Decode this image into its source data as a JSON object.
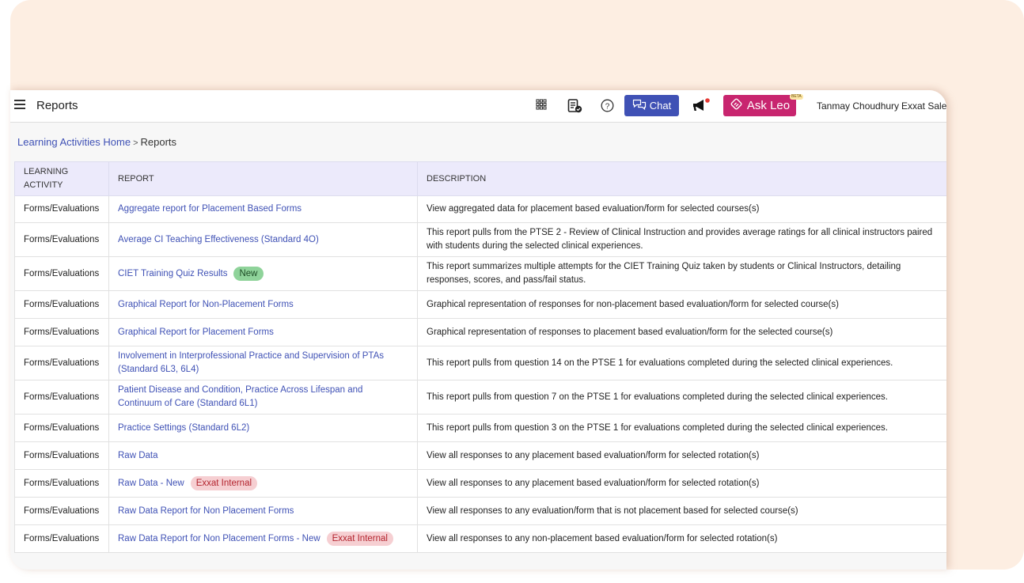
{
  "header": {
    "title": "Reports",
    "chat_label": "Chat",
    "ask_leo_label": "Ask Leo",
    "beta_label": "BETA",
    "user_name": "Tanmay Choudhury",
    "org_name": "Exxat Sales",
    "icons": [
      "menu-icon",
      "apps-grid-icon",
      "task-checklist-icon",
      "help-icon",
      "chat-icon",
      "megaphone-icon",
      "leo-logo-icon"
    ],
    "accent_colors": {
      "chat": "#3f51b5",
      "ask_leo": "#c8256f",
      "notification_dot": "#e53935"
    }
  },
  "breadcrumb": {
    "home": "Learning Activities Home",
    "separator": ">",
    "current": "Reports"
  },
  "table": {
    "headers": [
      "LEARNING ACTIVITY",
      "REPORT",
      "DESCRIPTION"
    ],
    "rows": [
      {
        "activity": "Forms/Evaluations",
        "report": "Aggregate report for Placement Based Forms",
        "badge": "",
        "description": "View aggregated data for placement based evaluation/form for selected courses(s)"
      },
      {
        "activity": "Forms/Evaluations",
        "report": "Average CI Teaching Effectiveness (Standard 4O)",
        "badge": "",
        "description": "This report pulls from the PTSE 2 - Review of Clinical Instruction and provides average ratings for all clinical instructors paired with students during the selected clinical experiences."
      },
      {
        "activity": "Forms/Evaluations",
        "report": "CIET Training Quiz Results",
        "badge": "New",
        "badge_type": "new",
        "description": "This report summarizes multiple attempts for the CIET Training Quiz taken by students or Clinical Instructors, detailing responses, scores, and pass/fail status."
      },
      {
        "activity": "Forms/Evaluations",
        "report": "Graphical Report for Non-Placement Forms",
        "badge": "",
        "description": "Graphical representation of responses for non-placement based evaluation/form for selected course(s)"
      },
      {
        "activity": "Forms/Evaluations",
        "report": "Graphical Report for Placement Forms",
        "badge": "",
        "description": "Graphical representation of responses to placement based evaluation/form for the selected course(s)"
      },
      {
        "activity": "Forms/Evaluations",
        "report": "Involvement in Interprofessional Practice and Supervision of PTAs (Standard 6L3, 6L4)",
        "badge": "",
        "description": "This report pulls from question 14 on the PTSE 1 for evaluations completed during the selected clinical experiences."
      },
      {
        "activity": "Forms/Evaluations",
        "report": "Patient Disease and Condition, Practice Across Lifespan and Continuum of Care (Standard 6L1)",
        "badge": "",
        "description": "This report pulls from question 7 on the PTSE 1 for evaluations completed during the selected clinical experiences."
      },
      {
        "activity": "Forms/Evaluations",
        "report": "Practice Settings (Standard 6L2)",
        "badge": "",
        "description": "This report pulls from question 3 on the PTSE 1 for evaluations completed during the selected clinical experiences."
      },
      {
        "activity": "Forms/Evaluations",
        "report": "Raw Data",
        "badge": "",
        "description": "View all responses to any placement based evaluation/form for selected rotation(s)"
      },
      {
        "activity": "Forms/Evaluations",
        "report": "Raw Data - New",
        "badge": "Exxat Internal",
        "badge_type": "internal",
        "description": "View all responses to any placement based evaluation/form for selected rotation(s)"
      },
      {
        "activity": "Forms/Evaluations",
        "report": "Raw Data Report for Non Placement Forms",
        "badge": "",
        "description": "View all responses to any evaluation/form that is not placement based for selected course(s)"
      },
      {
        "activity": "Forms/Evaluations",
        "report": "Raw Data Report for Non Placement Forms - New",
        "badge": "Exxat Internal",
        "badge_type": "internal",
        "description": "View all responses to any non-placement based evaluation/form for selected rotation(s)"
      }
    ]
  }
}
